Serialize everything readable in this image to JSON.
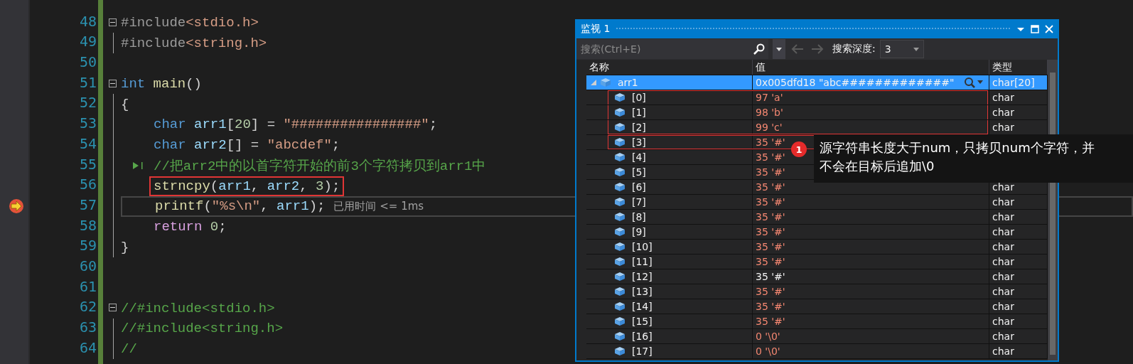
{
  "editor": {
    "lines": [
      {
        "number": "48",
        "collapsible": true,
        "indented": false,
        "tokens": [
          {
            "kind": "preproc",
            "text": "#include"
          },
          {
            "kind": "string",
            "text": "<stdio.h>"
          }
        ]
      },
      {
        "number": "49",
        "collapsible": false,
        "indented": false,
        "tokens": [
          {
            "kind": "preproc",
            "text": "#include"
          },
          {
            "kind": "string",
            "text": "<string.h>"
          }
        ]
      },
      {
        "number": "50",
        "collapsible": false
      },
      {
        "number": "51",
        "collapsible": true,
        "indented": false,
        "tokens": [
          {
            "kind": "keyword",
            "text": "int "
          },
          {
            "kind": "func",
            "text": "main"
          },
          {
            "kind": "punct",
            "text": "()"
          }
        ]
      },
      {
        "number": "52",
        "collapsible": false,
        "indented": false,
        "tokens": [
          {
            "kind": "punct",
            "text": "{"
          }
        ]
      },
      {
        "number": "53",
        "collapsible": false,
        "indented": true,
        "tokens": [
          {
            "kind": "keyword",
            "text": "char "
          },
          {
            "kind": "ident",
            "text": "arr1"
          },
          {
            "kind": "punct",
            "text": "["
          },
          {
            "kind": "number",
            "text": "20"
          },
          {
            "kind": "punct",
            "text": "] = "
          },
          {
            "kind": "string",
            "text": "\"################\""
          },
          {
            "kind": "punct",
            "text": ";"
          }
        ]
      },
      {
        "number": "54",
        "collapsible": false,
        "indented": true,
        "tokens": [
          {
            "kind": "keyword",
            "text": "char "
          },
          {
            "kind": "ident",
            "text": "arr2"
          },
          {
            "kind": "punct",
            "text": "[] = "
          },
          {
            "kind": "string",
            "text": "\"abcdef\""
          },
          {
            "kind": "punct",
            "text": ";"
          }
        ]
      },
      {
        "number": "55",
        "collapsible": false,
        "indented": true,
        "run_marker": true,
        "tokens": [
          {
            "kind": "comment",
            "text": "//把arr2中的以首字符开始的前3个字符拷贝到arr1中"
          }
        ]
      },
      {
        "number": "56",
        "collapsible": false,
        "indented": true,
        "boxed": true,
        "tokens": [
          {
            "kind": "func",
            "text": "strncpy"
          },
          {
            "kind": "punct",
            "text": "("
          },
          {
            "kind": "ident",
            "text": "arr1"
          },
          {
            "kind": "punct",
            "text": ", "
          },
          {
            "kind": "ident",
            "text": "arr2"
          },
          {
            "kind": "punct",
            "text": ", "
          },
          {
            "kind": "number",
            "text": "3"
          },
          {
            "kind": "punct",
            "text": ");"
          }
        ]
      },
      {
        "number": "57",
        "collapsible": false,
        "indented": true,
        "current": true,
        "hint": "已用时间 <= 1ms",
        "tokens": [
          {
            "kind": "func",
            "text": "printf"
          },
          {
            "kind": "punct",
            "text": "("
          },
          {
            "kind": "string",
            "text": "\"%s\\n\""
          },
          {
            "kind": "punct",
            "text": ", "
          },
          {
            "kind": "ident",
            "text": "arr1"
          },
          {
            "kind": "punct",
            "text": ");"
          }
        ]
      },
      {
        "number": "58",
        "collapsible": false,
        "indented": true,
        "tokens": [
          {
            "kind": "control",
            "text": "return "
          },
          {
            "kind": "number",
            "text": "0"
          },
          {
            "kind": "punct",
            "text": ";"
          }
        ]
      },
      {
        "number": "59",
        "collapsible": false,
        "indented": false,
        "tokens": [
          {
            "kind": "punct",
            "text": "}"
          }
        ]
      },
      {
        "number": "60",
        "collapsible": false
      },
      {
        "number": "61",
        "collapsible": false
      },
      {
        "number": "62",
        "collapsible": true,
        "indented": false,
        "tokens": [
          {
            "kind": "comment",
            "text": "//#include<stdio.h>"
          }
        ]
      },
      {
        "number": "63",
        "collapsible": false,
        "indented": false,
        "tokens": [
          {
            "kind": "comment",
            "text": "//#include<string.h>"
          }
        ]
      },
      {
        "number": "64",
        "collapsible": false,
        "indented": false,
        "tokens": [
          {
            "kind": "comment",
            "text": "//"
          }
        ]
      }
    ]
  },
  "watch": {
    "title": "监视 1",
    "search": {
      "placeholder": "搜索(Ctrl+E)"
    },
    "depth_label": "搜索深度:",
    "depth_value": "3",
    "columns": [
      "名称",
      "值",
      "类型"
    ],
    "rows": [
      {
        "name": "arr1",
        "value": "0x005dfd18 \"abc#############\"",
        "type": "char[20]",
        "selected": true,
        "expanded": true,
        "changed": false,
        "children": [
          {
            "name": "[0]",
            "value": "97 'a'",
            "type": "char",
            "changed": true,
            "selected": false,
            "boxed": true,
            "frame_start": true
          },
          {
            "name": "[1]",
            "value": "98 'b'",
            "type": "char",
            "changed": true,
            "selected": false,
            "boxed": true,
            "frame_start": false
          },
          {
            "name": "[2]",
            "value": "99 'c'",
            "type": "char",
            "changed": true,
            "selected": false,
            "boxed": true,
            "frame_start": false
          },
          {
            "name": "[3]",
            "value": "35 '#'",
            "changed": true,
            "selected": false,
            "boxed": true,
            "frame_start": true
          },
          {
            "name": "[4]",
            "value": "35 '#'",
            "changed": true,
            "selected": false
          },
          {
            "name": "[5]",
            "value": "35 '#'",
            "changed": true,
            "selected": false
          },
          {
            "name": "[6]",
            "value": "35 '#'",
            "type": "char",
            "changed": true,
            "selected": false
          },
          {
            "name": "[7]",
            "value": "35 '#'",
            "type": "char",
            "changed": true,
            "selected": false
          },
          {
            "name": "[8]",
            "value": "35 '#'",
            "type": "char",
            "changed": true,
            "selected": false
          },
          {
            "name": "[9]",
            "value": "35 '#'",
            "type": "char",
            "changed": true,
            "selected": false
          },
          {
            "name": "[10]",
            "value": "35 '#'",
            "type": "char",
            "changed": true,
            "selected": false
          },
          {
            "name": "[11]",
            "value": "35 '#'",
            "type": "char",
            "changed": true,
            "selected": false
          },
          {
            "name": "[12]",
            "value": "35 '#'",
            "type": "char",
            "changed": false,
            "selected": false
          },
          {
            "name": "[13]",
            "value": "35 '#'",
            "type": "char",
            "changed": true,
            "selected": false
          },
          {
            "name": "[14]",
            "value": "35 '#'",
            "type": "char",
            "changed": true,
            "selected": false
          },
          {
            "name": "[15]",
            "value": "35 '#'",
            "type": "char",
            "changed": true,
            "selected": false
          },
          {
            "name": "[16]",
            "value": "0 '\\0'",
            "type": "char",
            "changed": true,
            "selected": false
          },
          {
            "name": "[17]",
            "value": "0 '\\0'",
            "type": "char",
            "changed": true,
            "selected": false
          }
        ]
      }
    ]
  },
  "callout": {
    "badge": "1",
    "lines": [
      "源字符串长度大于num，只拷贝num个字符，并",
      "不会在目标后追加\\0"
    ]
  }
}
